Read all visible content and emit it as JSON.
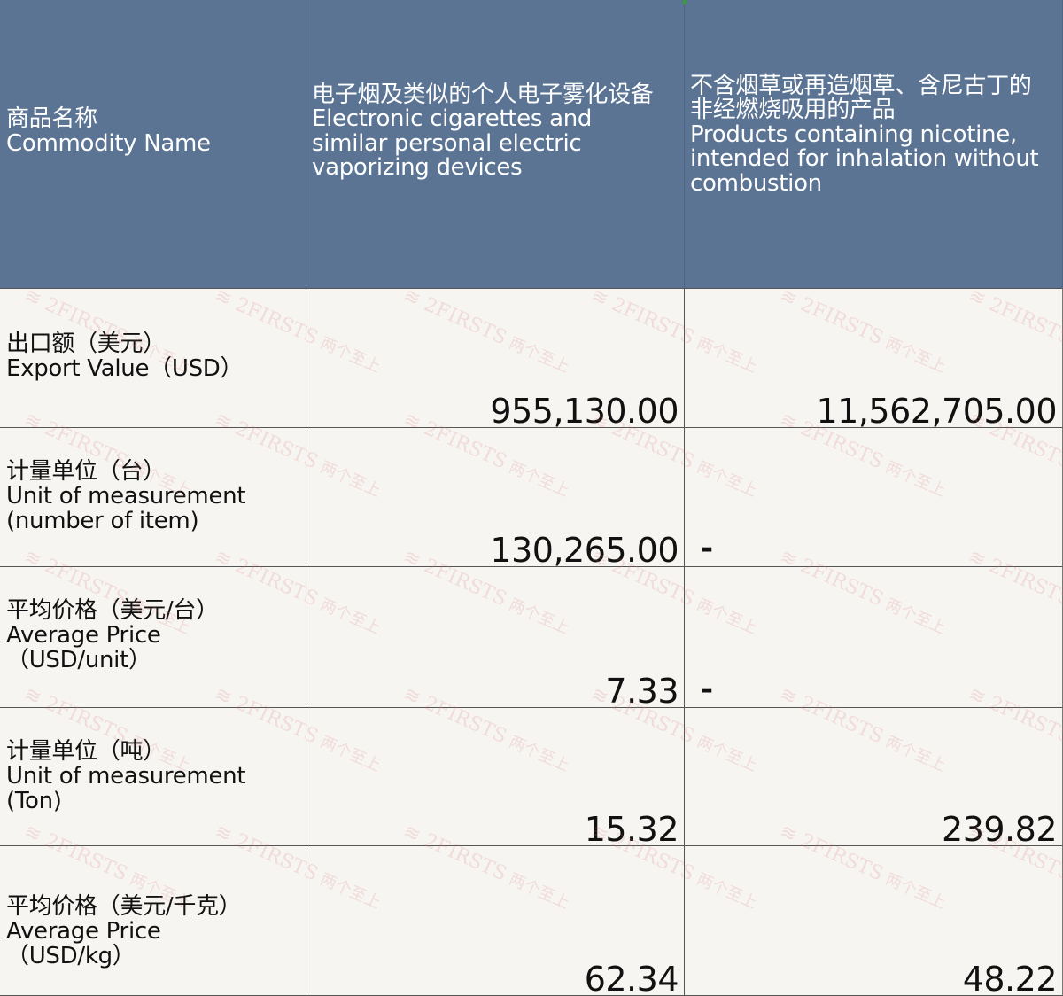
{
  "header": {
    "col1": "商品名称\nCommodity Name",
    "col2": "电子烟及类似的个人电子雾化设备\nElectronic cigarettes and\nsimilar personal electric\nvaporizing devices",
    "col3": "不含烟草或再造烟草、含尼古丁的\n非经燃烧吸用的产品\nProducts containing nicotine,\nintended for inhalation without\ncombustion"
  },
  "rows": [
    {
      "label": "出口额（美元）\n Export Value（USD）",
      "col2": "955,130.00",
      "col3": "11,562,705.00"
    },
    {
      "label": "计量单位（台）\nUnit of measurement\n(number of item)",
      "col2": "130,265.00",
      "col3": "-"
    },
    {
      "label": "平均价格（美元/台）\nAverage Price\n（USD/unit）",
      "col2": "7.33",
      "col3": "-"
    },
    {
      "label": "计量单位（吨）\nUnit of measurement\n(Ton)",
      "col2": "15.32",
      "col3": "239.82"
    },
    {
      "label": "平均价格（美元/千克）\nAverage Price\n（USD/kg）",
      "col2": "62.34",
      "col3": "48.22"
    }
  ],
  "watermark": {
    "brand": "2FIRSTS",
    "sub": "两个至上"
  },
  "colors": {
    "header_bg": "#5b7494",
    "header_text": "#ffffff",
    "body_bg": "#f7f5f2",
    "watermark": "#d67878"
  }
}
